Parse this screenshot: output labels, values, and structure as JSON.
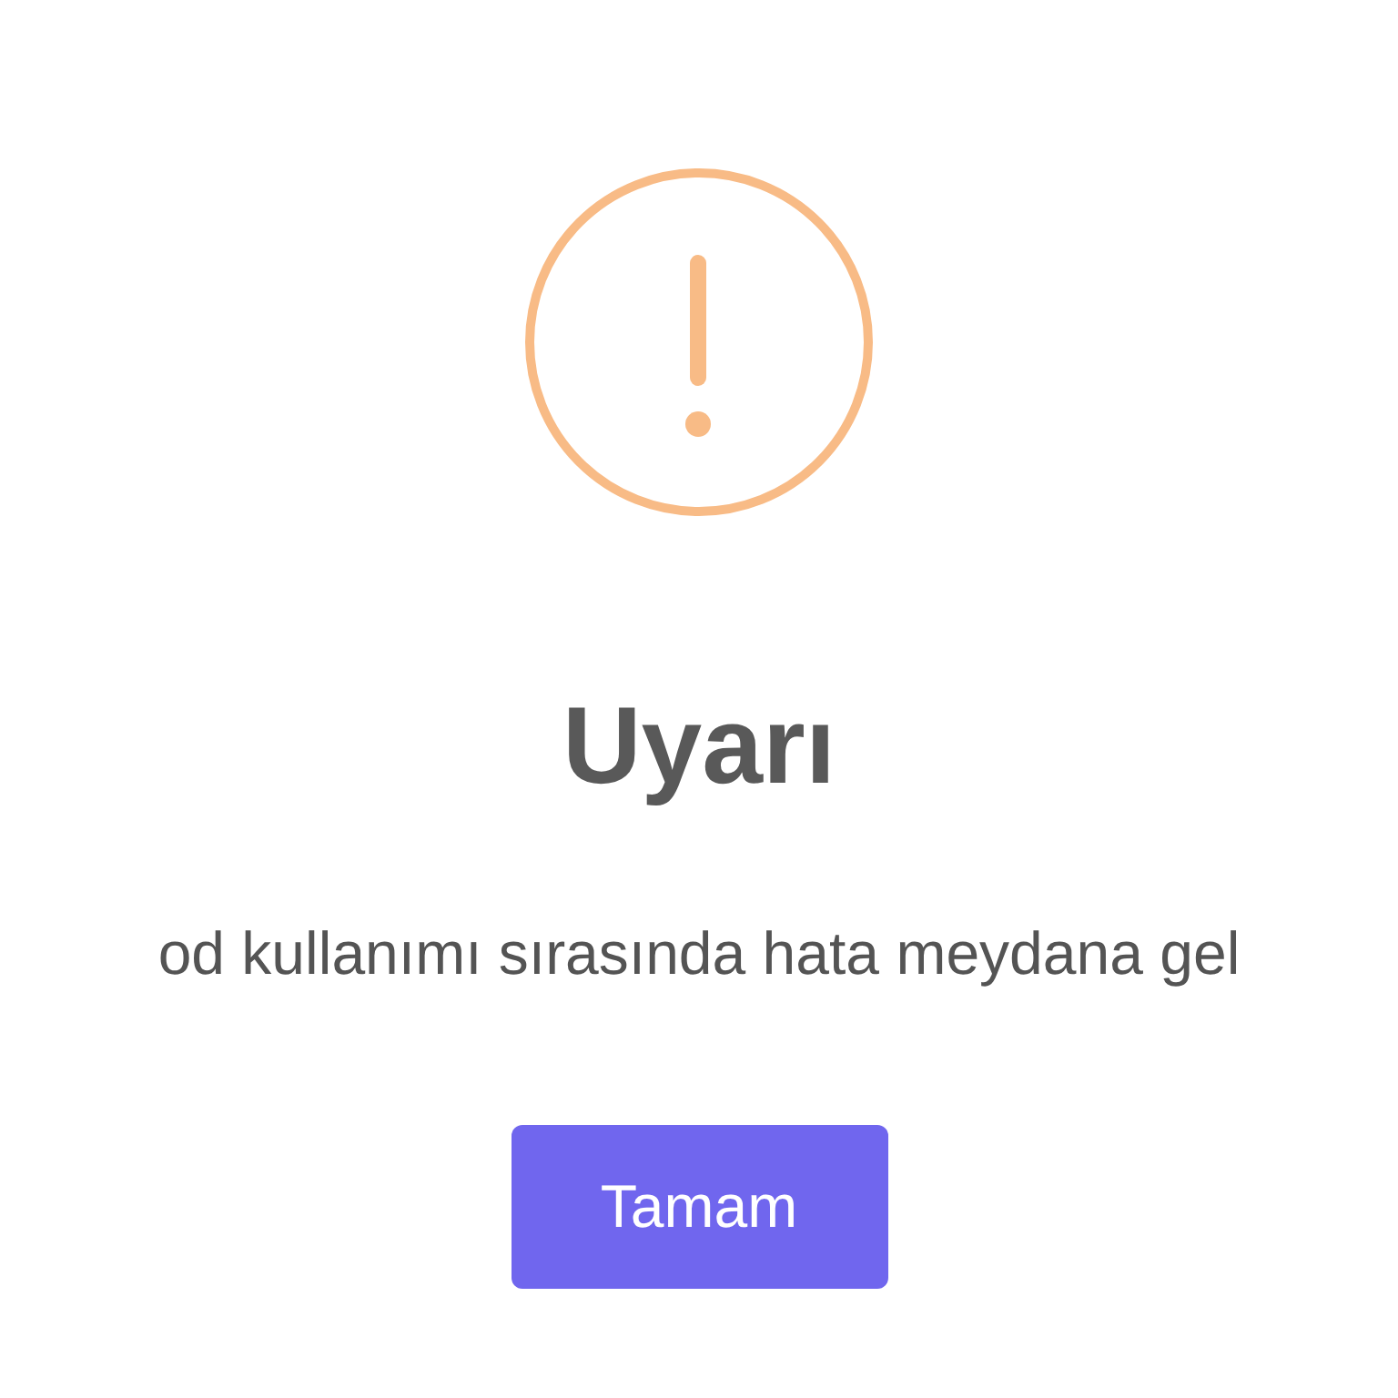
{
  "dialog": {
    "title": "Uyarı",
    "message": "od kullanımı sırasında hata meydana gel",
    "buttons": [
      {
        "label": "Tamam"
      }
    ]
  }
}
